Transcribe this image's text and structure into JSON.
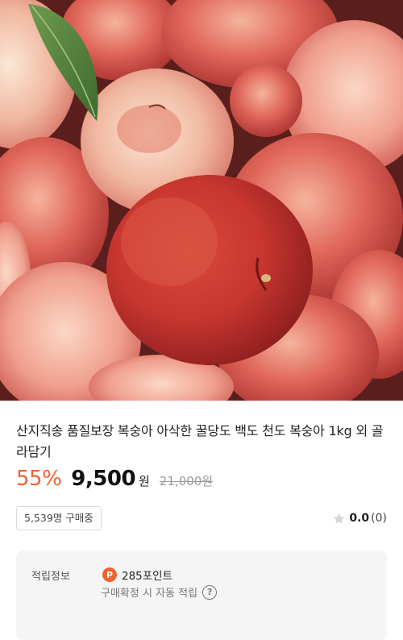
{
  "product": {
    "image_alt": "peaches-product-photo",
    "title": "산지직송 품질보장 복숭아 아삭한 꿀당도 백도 천도 복숭아 1kg 외 골라담기",
    "discount": "55%",
    "price": "9,500",
    "currency": "원",
    "original_price": "21,000원"
  },
  "buyers": {
    "label": "5,539명 구매중"
  },
  "rating": {
    "score": "0.0",
    "count": "(0)",
    "icon": "star-icon"
  },
  "reward": {
    "label": "적립정보",
    "badge": "P",
    "points": "285포인트",
    "note": "구매확정 시 자동 적립",
    "help": "?"
  },
  "colors": {
    "accent": "#f0622e",
    "price_text": "#111111",
    "muted": "#999999",
    "panel_bg": "#f5f5f5"
  }
}
